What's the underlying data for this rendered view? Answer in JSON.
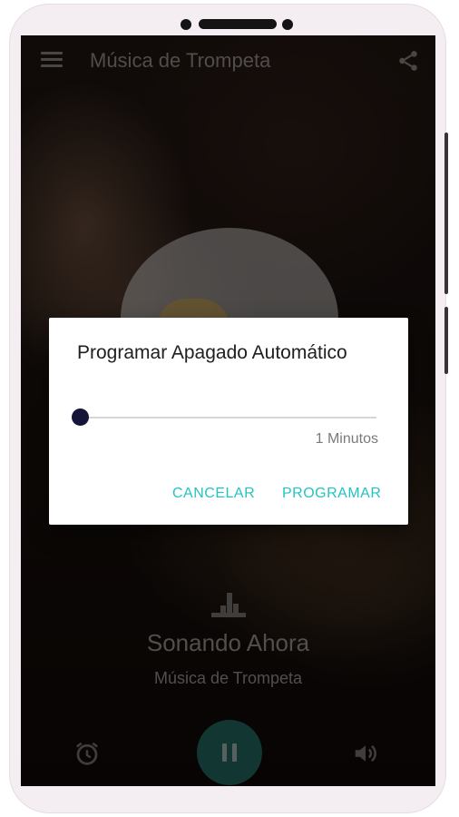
{
  "app": {
    "title": "Música de Trompeta"
  },
  "now_playing": {
    "heading": "Sonando Ahora",
    "station": "Música de Trompeta",
    "is_playing": true
  },
  "dialog": {
    "title": "Programar Apagado Automático",
    "slider_value_label": "1 Minutos",
    "slider_fraction": 0,
    "cancel_label": "CANCELAR",
    "confirm_label": "PROGRAMAR"
  },
  "icons": {
    "menu": "menu-icon",
    "share": "share-icon",
    "equalizer": "equalizer-icon",
    "alarm": "alarm-icon",
    "pause": "pause-icon",
    "volume": "volume-icon"
  },
  "colors": {
    "accent": "#22c4c0",
    "slider_thumb": "#15153a",
    "play_button": "#1f5d55"
  }
}
